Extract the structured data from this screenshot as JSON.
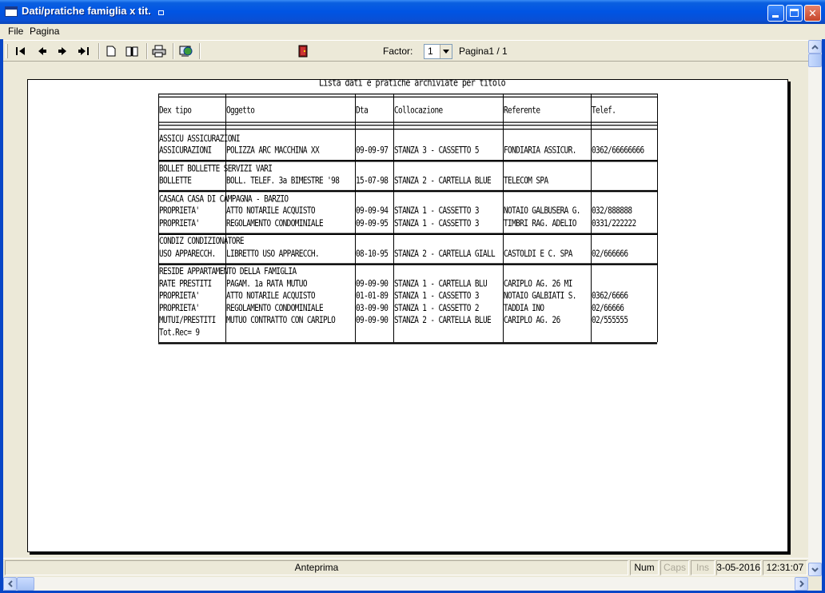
{
  "window": {
    "title": "Dati/pratiche famiglia x tit."
  },
  "menu": {
    "items": [
      "File",
      "Pagina"
    ]
  },
  "toolbar": {
    "factor_label": "Factor:",
    "factor_value": "1",
    "page_indicator": "Pagina1 / 1",
    "icons": [
      "first-page-icon",
      "prev-page-icon",
      "next-page-icon",
      "last-page-icon",
      "single-page-icon",
      "two-pages-icon",
      "print-icon",
      "export-icon",
      "exit-door-icon"
    ]
  },
  "report": {
    "title": "Lista dati e pratiche archiviate per titolo",
    "columns": [
      "Dex tipo",
      "Oggetto",
      "Dta",
      "Collocazione",
      "Referente",
      "Telef."
    ],
    "groups": [
      {
        "header": "ASSICU  ASSICURAZIONI",
        "rows": [
          [
            "ASSICURAZIONI",
            "POLIZZA ARC MACCHINA XX",
            "09-09-97",
            "STANZA 3 -  CASSETTO 5",
            "FONDIARIA ASSICUR.",
            "0362/66666666"
          ]
        ]
      },
      {
        "header": "BOLLET  BOLLETTE SERVIZI VARI",
        "rows": [
          [
            "BOLLETTE",
            "BOLL. TELEF. 3a BIMESTRE '98",
            "15-07-98",
            "STANZA 2 - CARTELLA BLUE",
            "TELECOM SPA",
            ""
          ]
        ]
      },
      {
        "header": "CASACA  CASA DI CAMPAGNA - BARZIO",
        "rows": [
          [
            "PROPRIETA'",
            "ATTO NOTARILE ACQUISTO",
            "09-09-94",
            "STANZA 1 - CASSETTO 3",
            "NOTAIO GALBUSERA G.",
            "032/888888"
          ],
          [
            "PROPRIETA'",
            "REGOLAMENTO CONDOMINIALE",
            "09-09-95",
            "STANZA 1 - CASSETTO 3",
            "TIMBRI RAG. ADELIO",
            "0331/222222"
          ]
        ]
      },
      {
        "header": "CONDIZ  CONDIZIONATORE",
        "rows": [
          [
            "USO APPARECCH.",
            "LIBRETTO USO APPARECCH.",
            "08-10-95",
            "STANZA 2 - CARTELLA GIALL",
            "CASTOLDI E C. SPA",
            "02/666666"
          ]
        ]
      },
      {
        "header": "RESIDE  APPARTAMENTO DELLA FAMIGLIA",
        "rows": [
          [
            "RATE PRESTITI",
            "PAGAM. 1a RATA MUTUO",
            "09-09-90",
            "STANZA 1  -  CARTELLA BLU",
            "CARIPLO AG. 26 MI",
            ""
          ],
          [
            "PROPRIETA'",
            "ATTO NOTARILE ACQUISTO",
            "01-01-89",
            "STANZA 1 - CASSETTO 3",
            "NOTAIO GALBIATI S.",
            "0362/6666"
          ],
          [
            "PROPRIETA'",
            "REGOLAMENTO CONDOMINIALE",
            "03-09-90",
            "STANZA 1 - CASSETTO  2",
            "TADDIA INO",
            "02/66666"
          ],
          [
            "MUTUI/PRESTITI",
            "MUTUO CONTRATTO CON CARIPLO",
            "09-09-90",
            "STANZA 2 - CARTELLA BLUE",
            "CARIPLO  AG. 26",
            "02/555555"
          ]
        ]
      }
    ],
    "total": "Tot.Rec= 9"
  },
  "status": {
    "mode": "Anteprima",
    "num": "Num",
    "caps": "Caps",
    "ins": "Ins",
    "date": "03-05-2016",
    "time": "12:31:07"
  }
}
